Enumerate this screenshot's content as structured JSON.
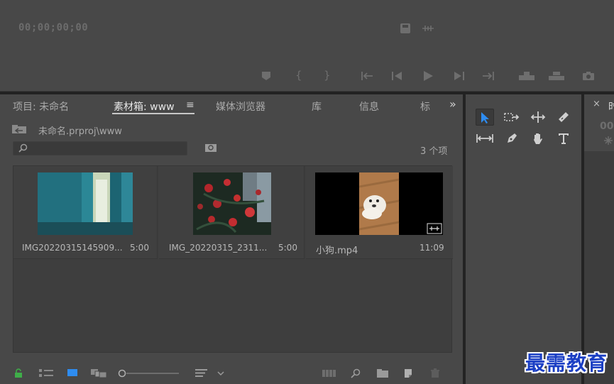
{
  "monitor": {
    "timecode": "00;00;00;00"
  },
  "project": {
    "tabs": [
      {
        "label": "项目: 未命名"
      },
      {
        "label": "素材箱: www"
      },
      {
        "label": "媒体浏览器"
      },
      {
        "label": "库"
      },
      {
        "label": "信息"
      },
      {
        "label": "标"
      }
    ],
    "active_tab_menu": "≡",
    "overflow": "»",
    "path": "未命名.prproj\\www",
    "search": {
      "value": "",
      "placeholder": ""
    },
    "item_count": "3 个项",
    "items": [
      {
        "name": "IMG20220315145909...",
        "duration": "5:00"
      },
      {
        "name": "IMG_20220315_2311...",
        "duration": "5:00"
      },
      {
        "name": "小狗.mp4",
        "duration": "11:09"
      }
    ]
  },
  "right_panel": {
    "close": "×",
    "tab_fragment": "时",
    "timecode_fragment": "00"
  },
  "watermark": "最需教育",
  "colors": {
    "panel_bg": "#484848",
    "bin_bg": "#3e3e3e",
    "accent": "#2e8cf0",
    "lock_green": "#3fae49"
  }
}
